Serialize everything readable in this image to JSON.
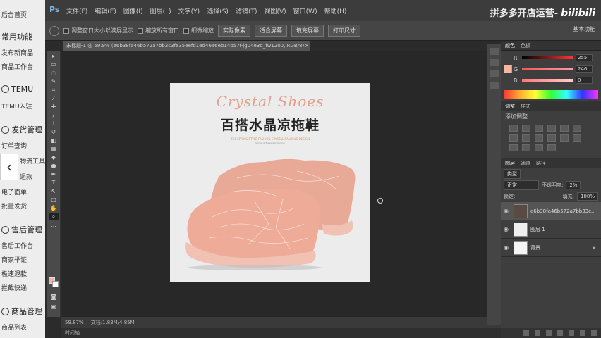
{
  "left_sidebar": {
    "items": [
      {
        "label": "后台首页"
      },
      {
        "label": "常用功能"
      },
      {
        "label": "发布新商品"
      },
      {
        "label": "商品工作台"
      },
      {
        "label": "TEMU"
      },
      {
        "label": "TEMU入驻"
      },
      {
        "label": "发货管理"
      },
      {
        "label": "订单查询"
      },
      {
        "label": "物流工具"
      },
      {
        "label": "退款"
      },
      {
        "label": "电子面单"
      },
      {
        "label": "批量发货"
      },
      {
        "label": "售后管理"
      },
      {
        "label": "售后工作台"
      },
      {
        "label": "商家举证"
      },
      {
        "label": "极速退款"
      },
      {
        "label": "拦截快递"
      },
      {
        "label": "商品管理"
      },
      {
        "label": "商品列表"
      }
    ],
    "back_arrow": "‹"
  },
  "photoshop": {
    "logo": "Ps",
    "menu": [
      "文件(F)",
      "编辑(E)",
      "图像(I)",
      "图层(L)",
      "文字(Y)",
      "选择(S)",
      "滤镜(T)",
      "视图(V)",
      "窗口(W)",
      "帮助(H)"
    ],
    "brand": "拼多多开店运营-",
    "brand_bili": "bilibili",
    "brand_sub": "基本功能",
    "options": {
      "resize_windows": "调整窗口大小以满屏显示",
      "zoom_all": "缩放所有窗口",
      "scrubby": "细微缩放",
      "actual_pixels": "实际像素",
      "fit_screen": "适合屏幕",
      "fill_screen": "填充屏幕",
      "print_size": "打印尺寸"
    },
    "doc_tab": "未标题-1 @ 59.9% (e6b38fa46b572a7bb2c3fe35eefd1ed46a6eb14b57f-jg04e3d_fw1200, RGB/8)",
    "canvas": {
      "script_title": "Crystal Shoes",
      "cn_title": "百搭水晶凉拖鞋",
      "tiny_line": "THE SPRING STYLE FASHION CRYSTAL SANDALS DESIGN",
      "tiny_line2": "Simple & Elegant Collection"
    },
    "status": {
      "zoom": "59.87%",
      "doc": "文档:1.83M/4.85M"
    },
    "status2": "时间轴",
    "color_panel": {
      "tabs": [
        "颜色",
        "色板"
      ],
      "r_value": "255",
      "g_value": "246",
      "b_value": "0",
      "r_label": "R",
      "g_label": "G",
      "b_label": "B",
      "swatch_color": "#f5b5a0"
    },
    "adjust_panel": {
      "tabs": [
        "调整",
        "样式"
      ],
      "title": "添加调整"
    },
    "layers_panel": {
      "tabs": [
        "图层",
        "通道",
        "路径"
      ],
      "kind": "类型",
      "blend": "正常",
      "opacity_label": "不透明度:",
      "opacity": "2%",
      "lock_label": "锁定:",
      "fill_label": "填充:",
      "fill": "100%",
      "layers": [
        {
          "name": "e6b38fa46b572a7bb33c..."
        },
        {
          "name": "图层 1"
        },
        {
          "name": "背景"
        }
      ]
    }
  }
}
